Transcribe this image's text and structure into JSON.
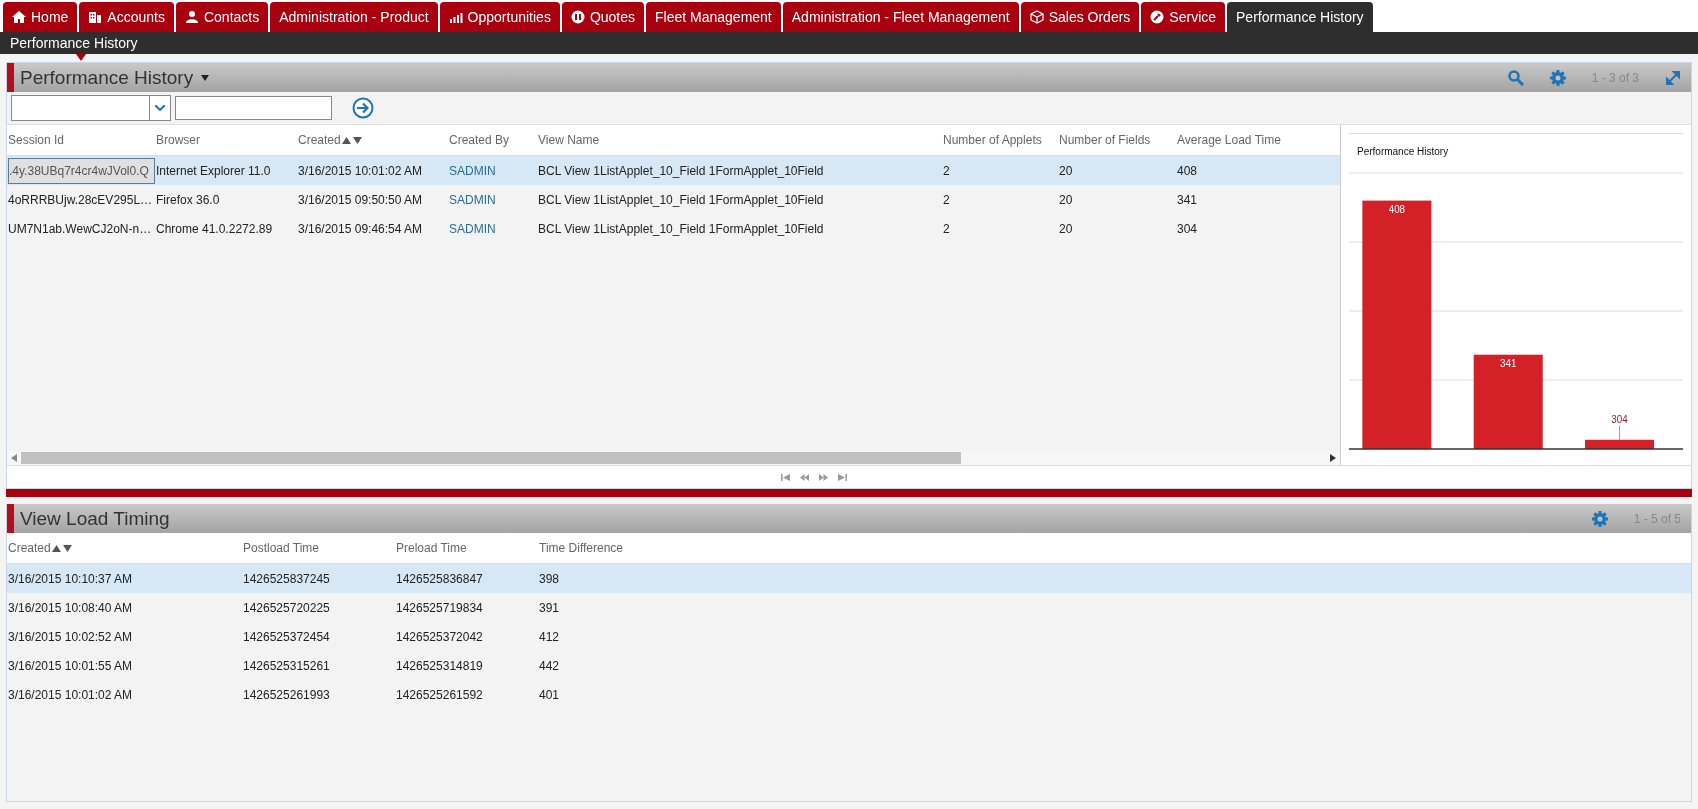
{
  "tabs": [
    {
      "label": "Home",
      "selected": false
    },
    {
      "label": "Accounts",
      "selected": false
    },
    {
      "label": "Contacts",
      "selected": false
    },
    {
      "label": "Administration - Product",
      "selected": false
    },
    {
      "label": "Opportunities",
      "selected": false
    },
    {
      "label": "Quotes",
      "selected": false
    },
    {
      "label": "Fleet Management",
      "selected": false
    },
    {
      "label": "Administration - Fleet Management",
      "selected": false
    },
    {
      "label": "Sales Orders",
      "selected": false
    },
    {
      "label": "Service",
      "selected": false
    },
    {
      "label": "Performance History",
      "selected": true
    }
  ],
  "subnav": {
    "label": "Performance History"
  },
  "performance_applet": {
    "title": "Performance History",
    "record_count": "1 - 3 of 3",
    "columns": [
      {
        "label": "Session Id",
        "sorted": false,
        "kind": "text"
      },
      {
        "label": "Browser",
        "sorted": false,
        "kind": "text"
      },
      {
        "label": "Created",
        "sorted": true,
        "kind": "text"
      },
      {
        "label": "Created By",
        "sorted": false,
        "kind": "link"
      },
      {
        "label": "View Name",
        "sorted": false,
        "kind": "text"
      },
      {
        "label": "Number of Applets",
        "sorted": false,
        "kind": "text"
      },
      {
        "label": "Number of Fields",
        "sorted": false,
        "kind": "text"
      },
      {
        "label": "Average Load Time",
        "sorted": false,
        "kind": "text"
      }
    ],
    "rows": [
      {
        "selected": true,
        "cells": [
          ".4y.38UBq7r4cr4wJVol0.Q",
          "Internet Explorer 11.0",
          "3/16/2015 10:01:02 AM",
          "SADMIN",
          "BCL View 1ListApplet_10_Field 1FormApplet_10Field",
          "2",
          "20",
          "408"
        ]
      },
      {
        "selected": false,
        "cells": [
          "4oRRRBUjw.28cEV295L…",
          "Firefox 36.0",
          "3/16/2015 09:50:50 AM",
          "SADMIN",
          "BCL View 1ListApplet_10_Field 1FormApplet_10Field",
          "2",
          "20",
          "341"
        ]
      },
      {
        "selected": false,
        "cells": [
          "UM7N1ab.WewCJ2oN-n…",
          "Chrome 41.0.2272.89",
          "3/16/2015 09:46:54 AM",
          "SADMIN",
          "BCL View 1ListApplet_10_Field 1FormApplet_10Field",
          "2",
          "20",
          "304"
        ]
      }
    ],
    "chart": {
      "chart_data": {
        "type": "bar",
        "title": "Performance History",
        "ylim": [
          300,
          420
        ],
        "data_labels": true,
        "series": [
          {
            "color": "#d42027",
            "values": [
              408,
              341,
              304
            ]
          }
        ]
      }
    }
  },
  "timing_applet": {
    "title": "View Load Timing",
    "record_count": "1 - 5 of 5",
    "columns": [
      {
        "label": "Created",
        "sorted": true
      },
      {
        "label": "Postload Time",
        "sorted": false
      },
      {
        "label": "Preload Time",
        "sorted": false
      },
      {
        "label": "Time Difference",
        "sorted": false
      }
    ],
    "rows": [
      {
        "selected": true,
        "cells": [
          "3/16/2015 10:10:37 AM",
          "1426525837245",
          "1426525836847",
          "398"
        ]
      },
      {
        "selected": false,
        "cells": [
          "3/16/2015 10:08:40 AM",
          "1426525720225",
          "1426525719834",
          "391"
        ]
      },
      {
        "selected": false,
        "cells": [
          "3/16/2015 10:02:52 AM",
          "1426525372454",
          "1426525372042",
          "412"
        ]
      },
      {
        "selected": false,
        "cells": [
          "3/16/2015 10:01:55 AM",
          "1426525315261",
          "1426525314819",
          "442"
        ]
      },
      {
        "selected": false,
        "cells": [
          "3/16/2015 10:01:02 AM",
          "1426525261993",
          "1426525261592",
          "401"
        ]
      }
    ]
  }
}
